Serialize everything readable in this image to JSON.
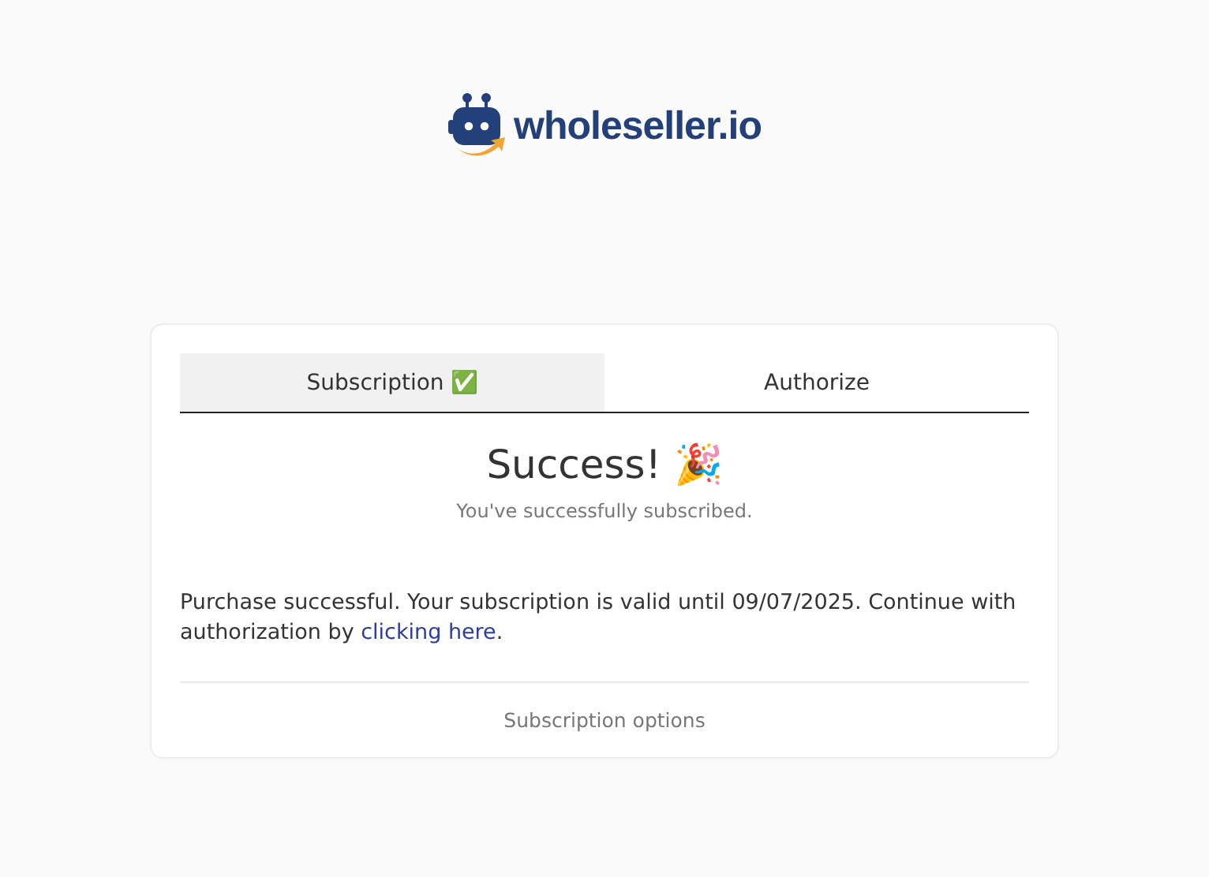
{
  "brand": {
    "name": "wholeseller.io"
  },
  "tabs": [
    {
      "label": "Subscription ✅",
      "selected": true
    },
    {
      "label": "Authorize",
      "selected": false
    }
  ],
  "heading": "Success! 🎉",
  "subheading": "You've successfully subscribed.",
  "message": {
    "before": "Purchase successful. Your subscription is valid until 09/07/2025. Continue with authorization by ",
    "link": "clicking here",
    "after": "."
  },
  "footer_link": "Subscription options"
}
